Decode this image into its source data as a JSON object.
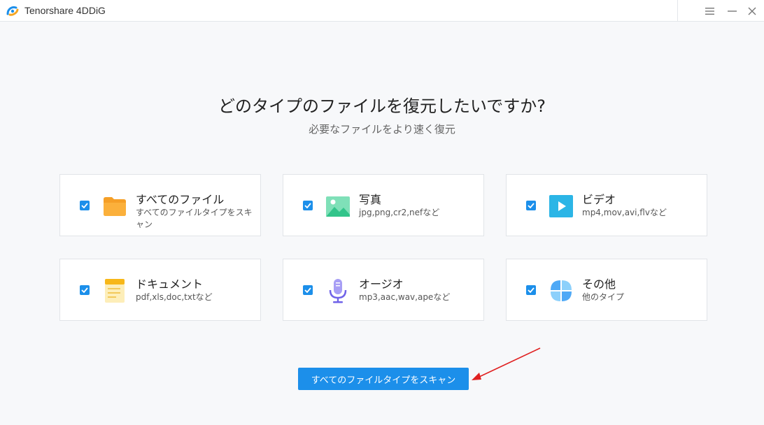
{
  "app": {
    "title": "Tenorshare 4DDiG"
  },
  "window_controls": {
    "menu_icon": "hamburger-icon",
    "minimize_icon": "minimize-icon",
    "close_icon": "close-icon"
  },
  "main": {
    "heading": "どのタイプのファイルを復元したいですか?",
    "subheading": "必要なファイルをより速く復元"
  },
  "file_types": [
    {
      "title": "すべてのファイル",
      "desc": "すべてのファイルタイプをスキャン",
      "icon": "folder-icon",
      "checked": true
    },
    {
      "title": "写真",
      "desc": "jpg,png,cr2,nefなど",
      "icon": "photo-icon",
      "checked": true
    },
    {
      "title": "ビデオ",
      "desc": "mp4,mov,avi,flvなど",
      "icon": "video-icon",
      "checked": true
    },
    {
      "title": "ドキュメント",
      "desc": "pdf,xls,doc,txtなど",
      "icon": "document-icon",
      "checked": true
    },
    {
      "title": "オージオ",
      "desc": "mp3,aac,wav,apeなど",
      "icon": "microphone-icon",
      "checked": true
    },
    {
      "title": "その他",
      "desc": "他のタイプ",
      "icon": "other-icon",
      "checked": true
    }
  ],
  "scan_button": {
    "label": "すべてのファイルタイプをスキャン"
  },
  "colors": {
    "accent": "#1c8fea",
    "annotation_arrow": "#e02020"
  }
}
